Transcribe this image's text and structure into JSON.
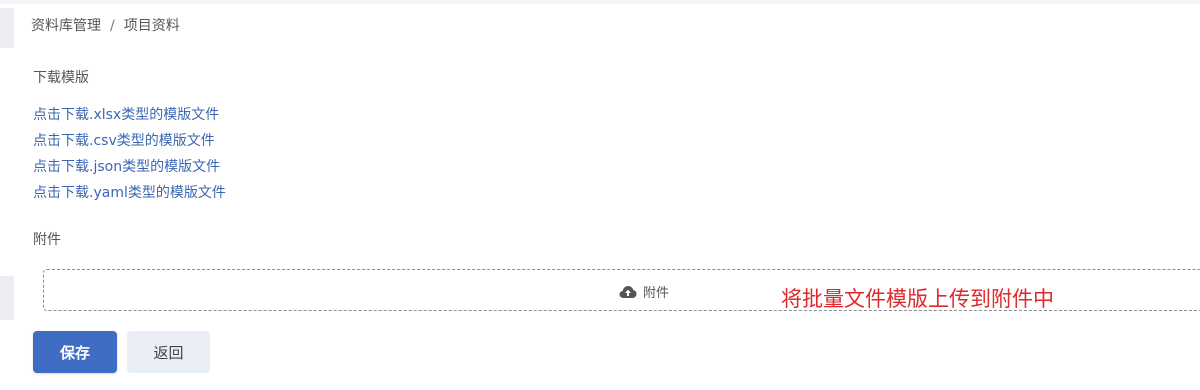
{
  "breadcrumb": {
    "root": "资料库管理",
    "separator": "/",
    "current": "项目资料"
  },
  "template_section": {
    "label": "下载模版",
    "links": [
      "点击下载.xlsx类型的模版文件",
      "点击下载.csv类型的模版文件",
      "点击下载.json类型的模版文件",
      "点击下载.yaml类型的模版文件"
    ]
  },
  "attachment_section": {
    "label": "附件",
    "upload_label": "附件",
    "upload_icon": "cloud-upload-icon"
  },
  "annotation": "将批量文件模版上传到附件中",
  "buttons": {
    "save": "保存",
    "back": "返回"
  },
  "colors": {
    "link": "#3b67b2",
    "primary": "#3f6dc4",
    "annotation": "#e0292c"
  }
}
